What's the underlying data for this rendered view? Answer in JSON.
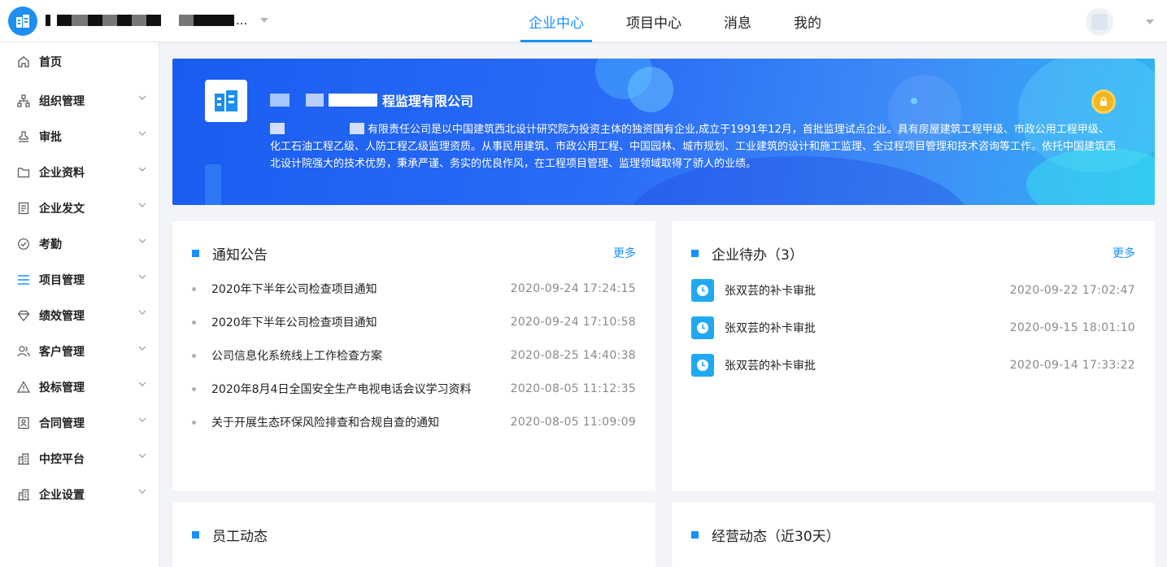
{
  "header": {
    "org_name_suffix": "...",
    "tabs": [
      {
        "label": "企业中心",
        "active": true
      },
      {
        "label": "项目中心",
        "active": false
      },
      {
        "label": "消息",
        "active": false
      },
      {
        "label": "我的",
        "active": false
      }
    ],
    "accent_color": "#1890ff"
  },
  "sidebar": {
    "items": [
      {
        "label": "首页",
        "icon": "home-icon",
        "has_children": false
      },
      {
        "label": "组织管理",
        "icon": "org-chart-icon",
        "has_children": true
      },
      {
        "label": "审批",
        "icon": "stamp-icon",
        "has_children": true
      },
      {
        "label": "企业资料",
        "icon": "folder-icon",
        "has_children": true
      },
      {
        "label": "企业发文",
        "icon": "document-icon",
        "has_children": true
      },
      {
        "label": "考勤",
        "icon": "check-badge-icon",
        "has_children": true
      },
      {
        "label": "项目管理",
        "icon": "list-icon",
        "has_children": true
      },
      {
        "label": "绩效管理",
        "icon": "diamond-icon",
        "has_children": true
      },
      {
        "label": "客户管理",
        "icon": "users-icon",
        "has_children": true
      },
      {
        "label": "投标管理",
        "icon": "warning-triangle-icon",
        "has_children": true
      },
      {
        "label": "合同管理",
        "icon": "contract-icon",
        "has_children": true
      },
      {
        "label": "中控平台",
        "icon": "building-icon",
        "has_children": true
      },
      {
        "label": "企业设置",
        "icon": "building-settings-icon",
        "has_children": true
      }
    ]
  },
  "banner": {
    "title_visible": "程监理有限公司",
    "description_visible": "有限责任公司是以中国建筑西北设计研究院为投资主体的独资国有企业,成立于1991年12月，首批监理试点企业。具有房屋建筑工程甲级、市政公用工程甲级、化工石油工程乙级、人防工程乙级监理资质。从事民用建筑、市政公用工程、中国园林、城市规划、工业建筑的设计和施工监理、全过程项目管理和技术咨询等工作。依托中国建筑西北设计院强大的技术优势，秉承严谨、务实的优良作风，在工程项目管理、监理领域取得了骄人的业绩。"
  },
  "notices": {
    "title": "通知公告",
    "more": "更多",
    "items": [
      {
        "text": "2020年下半年公司检查项目通知",
        "time": "2020-09-24 17:24:15"
      },
      {
        "text": "2020年下半年公司检查项目通知",
        "time": "2020-09-24 17:10:58"
      },
      {
        "text": "公司信息化系统线上工作检查方案",
        "time": "2020-08-25 14:40:38"
      },
      {
        "text": "2020年8月4日全国安全生产电视电话会议学习资料",
        "time": "2020-08-05 11:12:35"
      },
      {
        "text": "关于开展生态环保风险排查和合规自查的通知",
        "time": "2020-08-05 11:09:09"
      }
    ]
  },
  "todos": {
    "title": "企业待办（3）",
    "more": "更多",
    "items": [
      {
        "text": "张双芸的补卡审批",
        "time": "2020-09-22 17:02:47"
      },
      {
        "text": "张双芸的补卡审批",
        "time": "2020-09-15 18:01:10"
      },
      {
        "text": "张双芸的补卡审批",
        "time": "2020-09-14 17:33:22"
      }
    ]
  },
  "staff": {
    "title": "员工动态"
  },
  "business": {
    "title": "经营动态（近30天）"
  }
}
